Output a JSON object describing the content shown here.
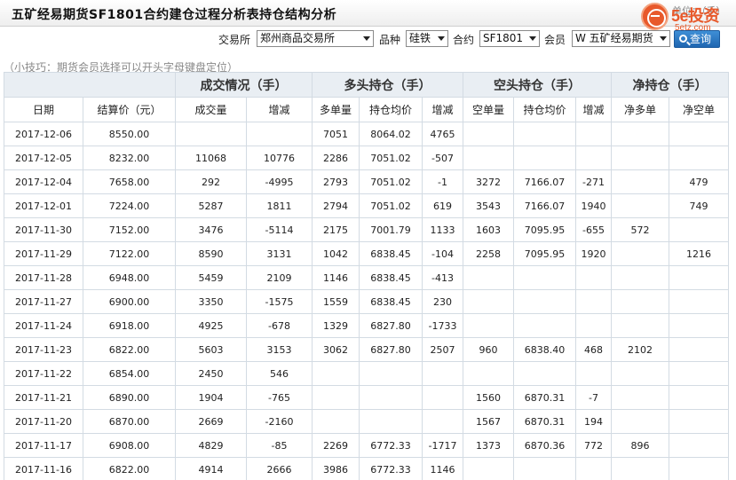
{
  "page_title": "五矿经易期货SF1801合约建仓过程分析表持仓结构分析",
  "unit_label": "单位：（手）",
  "logo": {
    "brand": "5e投资",
    "domain": "5etz.com"
  },
  "filters": {
    "exchange_label": "交易所",
    "exchange_value": "郑州商品交易所",
    "variety_label": "品种",
    "variety_value": "硅铁",
    "contract_label": "合约",
    "contract_value": "SF1801",
    "member_label": "会员",
    "member_value": "W 五矿经易期货",
    "query_label": "查询"
  },
  "tip": "（小技巧：期货会员选择可以开头字母键盘定位）",
  "table": {
    "groups": [
      "成交情况（手）",
      "多头持仓（手）",
      "空头持仓（手）",
      "净持仓（手）"
    ],
    "columns": [
      "日期",
      "结算价（元）",
      "成交量",
      "增减",
      "多单量",
      "持仓均价",
      "增减",
      "空单量",
      "持仓均价",
      "增减",
      "净多单",
      "净空单"
    ],
    "rows": [
      [
        "2017-12-06",
        "8550.00",
        "",
        "",
        "7051",
        "8064.02",
        "4765",
        "",
        "",
        "",
        "",
        ""
      ],
      [
        "2017-12-05",
        "8232.00",
        "11068",
        "10776",
        "2286",
        "7051.02",
        "-507",
        "",
        "",
        "",
        "",
        ""
      ],
      [
        "2017-12-04",
        "7658.00",
        "292",
        "-4995",
        "2793",
        "7051.02",
        "-1",
        "3272",
        "7166.07",
        "-271",
        "",
        "479"
      ],
      [
        "2017-12-01",
        "7224.00",
        "5287",
        "1811",
        "2794",
        "7051.02",
        "619",
        "3543",
        "7166.07",
        "1940",
        "",
        "749"
      ],
      [
        "2017-11-30",
        "7152.00",
        "3476",
        "-5114",
        "2175",
        "7001.79",
        "1133",
        "1603",
        "7095.95",
        "-655",
        "572",
        ""
      ],
      [
        "2017-11-29",
        "7122.00",
        "8590",
        "3131",
        "1042",
        "6838.45",
        "-104",
        "2258",
        "7095.95",
        "1920",
        "",
        "1216"
      ],
      [
        "2017-11-28",
        "6948.00",
        "5459",
        "2109",
        "1146",
        "6838.45",
        "-413",
        "",
        "",
        "",
        "",
        ""
      ],
      [
        "2017-11-27",
        "6900.00",
        "3350",
        "-1575",
        "1559",
        "6838.45",
        "230",
        "",
        "",
        "",
        "",
        ""
      ],
      [
        "2017-11-24",
        "6918.00",
        "4925",
        "-678",
        "1329",
        "6827.80",
        "-1733",
        "",
        "",
        "",
        "",
        ""
      ],
      [
        "2017-11-23",
        "6822.00",
        "5603",
        "3153",
        "3062",
        "6827.80",
        "2507",
        "960",
        "6838.40",
        "468",
        "2102",
        ""
      ],
      [
        "2017-11-22",
        "6854.00",
        "2450",
        "546",
        "",
        "",
        "",
        "",
        "",
        "",
        "",
        ""
      ],
      [
        "2017-11-21",
        "6890.00",
        "1904",
        "-765",
        "",
        "",
        "",
        "1560",
        "6870.31",
        "-7",
        "",
        ""
      ],
      [
        "2017-11-20",
        "6870.00",
        "2669",
        "-2160",
        "",
        "",
        "",
        "1567",
        "6870.31",
        "194",
        "",
        ""
      ],
      [
        "2017-11-17",
        "6908.00",
        "4829",
        "-85",
        "2269",
        "6772.33",
        "-1717",
        "1373",
        "6870.36",
        "772",
        "896",
        ""
      ],
      [
        "2017-11-16",
        "6822.00",
        "4914",
        "2666",
        "3986",
        "6772.33",
        "1146",
        "",
        "",
        "",
        "",
        ""
      ]
    ]
  },
  "colors": {
    "increase": "#e02020",
    "decrease": "#14961e",
    "header_bg": "#e9eef3",
    "button": "#2a78c4"
  }
}
